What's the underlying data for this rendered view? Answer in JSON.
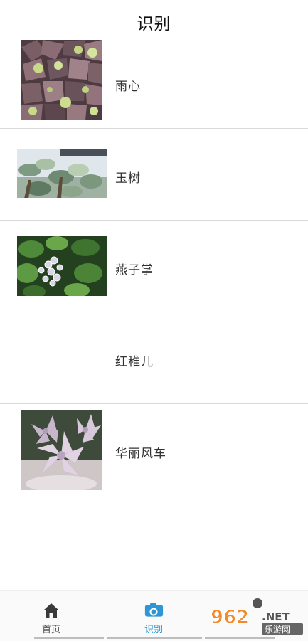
{
  "header": {
    "title": "识别"
  },
  "results": [
    {
      "name": "雨心"
    },
    {
      "name": "玉树"
    },
    {
      "name": "燕子掌"
    },
    {
      "name": "红稚儿"
    },
    {
      "name": "华丽风车"
    }
  ],
  "tabbar": {
    "tabs": [
      {
        "label": "首页",
        "icon": "home-icon",
        "active": false
      },
      {
        "label": "识别",
        "icon": "camera-icon",
        "active": true
      }
    ],
    "active_color": "#2f96d6"
  },
  "watermark": {
    "text": "962",
    "suffix": ".NET",
    "subtitle": "乐游网"
  }
}
